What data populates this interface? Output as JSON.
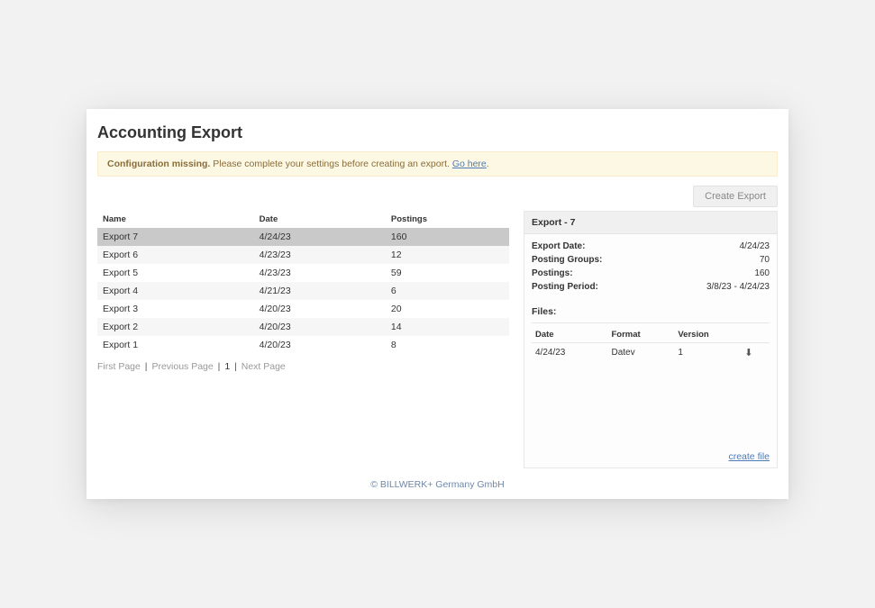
{
  "page": {
    "title": "Accounting Export"
  },
  "alert": {
    "bold": "Configuration missing.",
    "text": " Please complete your settings before creating an export. ",
    "link": "Go here",
    "after": "."
  },
  "toolbar": {
    "create_export_label": "Create Export"
  },
  "table": {
    "headers": {
      "name": "Name",
      "date": "Date",
      "postings": "Postings"
    },
    "rows": [
      {
        "name": "Export 7",
        "date": "4/24/23",
        "postings": "160",
        "selected": true
      },
      {
        "name": "Export 6",
        "date": "4/23/23",
        "postings": "12"
      },
      {
        "name": "Export 5",
        "date": "4/23/23",
        "postings": "59"
      },
      {
        "name": "Export 4",
        "date": "4/21/23",
        "postings": "6"
      },
      {
        "name": "Export 3",
        "date": "4/20/23",
        "postings": "20"
      },
      {
        "name": "Export 2",
        "date": "4/20/23",
        "postings": "14"
      },
      {
        "name": "Export 1",
        "date": "4/20/23",
        "postings": "8"
      }
    ]
  },
  "pager": {
    "first": "First Page",
    "prev": "Previous Page",
    "current": "1",
    "next": "Next Page"
  },
  "detail": {
    "title": "Export - 7",
    "rows": {
      "export_date_k": "Export Date:",
      "export_date_v": "4/24/23",
      "posting_groups_k": "Posting Groups:",
      "posting_groups_v": "70",
      "postings_k": "Postings:",
      "postings_v": "160",
      "posting_period_k": "Posting Period:",
      "posting_period_v": "3/8/23 - 4/24/23"
    },
    "files_header": "Files:",
    "files_cols": {
      "date": "Date",
      "format": "Format",
      "version": "Version"
    },
    "files": [
      {
        "date": "4/24/23",
        "format": "Datev",
        "version": "1"
      }
    ],
    "create_file": "create file"
  },
  "footer": "© BILLWERK+ Germany GmbH"
}
